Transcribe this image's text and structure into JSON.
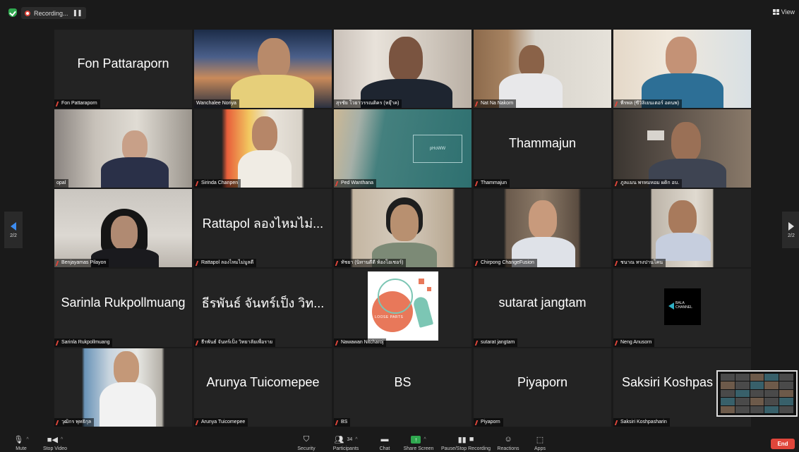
{
  "topbar": {
    "recording_label": "Recording...",
    "pause_glyph": "❚❚",
    "view_label": "View"
  },
  "participants": [
    {
      "name": "Fon Pattaraporn",
      "display": "Fon Pattaraporn",
      "video": false
    },
    {
      "name": "Wanchalee Noriya",
      "video": true
    },
    {
      "name": "สุรชัย โวยาวรรณติคร (หยุ๊าค)",
      "video": true,
      "active": true
    },
    {
      "name": "Nat Na Nakorn",
      "video": true
    },
    {
      "name": "พีรพล (ซีวิลิเยนเตอร์ อดนพ)",
      "video": true
    },
    {
      "name": "opal",
      "video": true
    },
    {
      "name": "Sirinda Chanpen",
      "video": true
    },
    {
      "name": "Ped Wanthana",
      "video": true
    },
    {
      "name": "Thammajun",
      "display": "Thammajun",
      "video": false
    },
    {
      "name": "ภูลแมน พรหมหอม ผดิก อบ.",
      "video": true
    },
    {
      "name": "Benjayamas Pilayon",
      "video": true
    },
    {
      "name": "Rattapol ลองไหมไม่มูลดี",
      "display": "Rattapol ลองไหมไม่...",
      "video": false
    },
    {
      "name": "ทัชยา (นิทานตีตี ห้องโอเชอร์)",
      "video": true
    },
    {
      "name": "Chirpong ChangeFusion",
      "video": true
    },
    {
      "name": "ชนาณ ทรงปานโคน",
      "video": true
    },
    {
      "name": "Sarinla Rukpollmuang",
      "display": "Sarinla Rukpollmuang",
      "video": false
    },
    {
      "name": "ธีรพันธ์ จันทร์เป็ง วิทยาลัยเพื่อราย",
      "display": "ธีรพันธ์ จันทร์เป็ง วิท...",
      "video": false
    },
    {
      "name": "Nawawan Nitcharoj",
      "video": true
    },
    {
      "name": "sutarat jangtam",
      "display": "sutarat jangtam",
      "video": false
    },
    {
      "name": "Neng Anusorn",
      "video": true
    },
    {
      "name": "วุฒิกร พุทธิกุล",
      "video": true
    },
    {
      "name": "Arunya Tuicomepee",
      "display": "Arunya Tuicomepee",
      "video": false
    },
    {
      "name": "BS",
      "display": "BS",
      "video": false
    },
    {
      "name": "Piyaporn",
      "display": "Piyaporn",
      "video": false
    },
    {
      "name": "Saksiri Koshpasharin",
      "display": "Saksiri Koshpas",
      "video": false
    }
  ],
  "tile_texts": {
    "loose_parts": "LOOSE PARTS",
    "bala_line1": "BALA",
    "bala_line2": "CHANNEL",
    "pp_screen": "pHoWW"
  },
  "nav": {
    "prev_page": "2/2",
    "next_page": "2/2"
  },
  "toolbar": {
    "mute": "Mute",
    "stop_video": "Stop Video",
    "security": "Security",
    "participants": "Participants",
    "participants_count": "34",
    "chat": "Chat",
    "share_screen": "Share Screen",
    "pause_recording": "Pause/Stop Recording",
    "reactions": "Reactions",
    "apps": "Apps",
    "end": "End"
  },
  "colors": {
    "background": "#1a1a1a",
    "tile": "#232323",
    "active_border": "#e6dc6a",
    "end_button": "#e0463b",
    "share_green": "#2fa84f",
    "nav_arrow_blue": "#3d8cf0"
  }
}
